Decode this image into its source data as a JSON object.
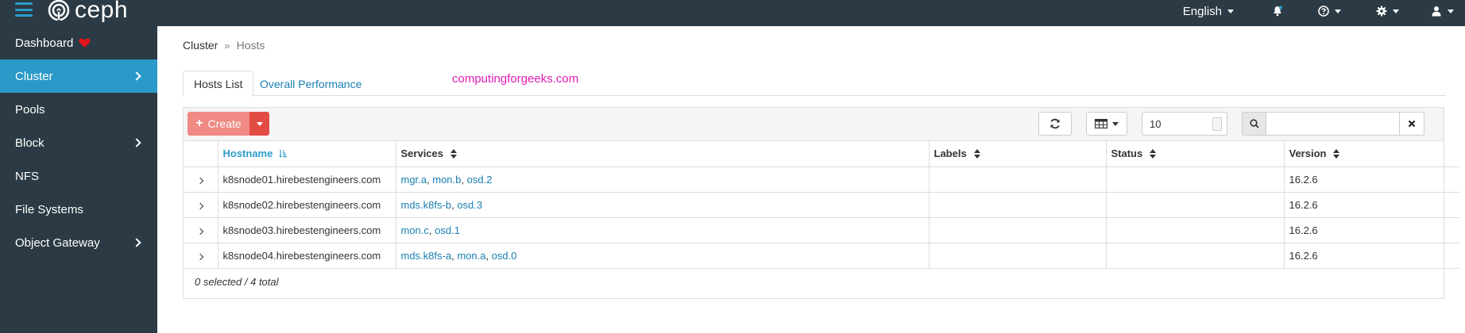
{
  "brand": {
    "name": "ceph"
  },
  "navbar": {
    "language": "English",
    "icons": [
      "bell-icon",
      "help-icon",
      "gear-icon",
      "user-icon"
    ]
  },
  "sidebar": {
    "items": [
      {
        "label": "Dashboard",
        "active": false,
        "has_children": false
      },
      {
        "label": "Cluster",
        "active": true,
        "has_children": true
      },
      {
        "label": "Pools",
        "active": false,
        "has_children": false
      },
      {
        "label": "Block",
        "active": false,
        "has_children": true
      },
      {
        "label": "NFS",
        "active": false,
        "has_children": false
      },
      {
        "label": "File Systems",
        "active": false,
        "has_children": false
      },
      {
        "label": "Object Gateway",
        "active": false,
        "has_children": true
      }
    ]
  },
  "breadcrumb": {
    "parent": "Cluster",
    "current": "Hosts"
  },
  "tabs": [
    {
      "label": "Hosts List",
      "active": true
    },
    {
      "label": "Overall Performance",
      "active": false
    }
  ],
  "watermark": "computingforgeeks.com",
  "toolbar": {
    "create_label": "Create",
    "page_size": "10",
    "search_value": ""
  },
  "table": {
    "columns": [
      "Hostname",
      "Services",
      "Labels",
      "Status",
      "Version"
    ],
    "sorted_column": "Hostname",
    "rows": [
      {
        "hostname": "k8snode01.hirebestengineers.com",
        "services": [
          "mgr.a",
          "mon.b",
          "osd.2"
        ],
        "labels": "",
        "status": "",
        "version": "16.2.6"
      },
      {
        "hostname": "k8snode02.hirebestengineers.com",
        "services": [
          "mds.k8fs-b",
          "osd.3"
        ],
        "labels": "",
        "status": "",
        "version": "16.2.6"
      },
      {
        "hostname": "k8snode03.hirebestengineers.com",
        "services": [
          "mon.c",
          "osd.1"
        ],
        "labels": "",
        "status": "",
        "version": "16.2.6"
      },
      {
        "hostname": "k8snode04.hirebestengineers.com",
        "services": [
          "mds.k8fs-a",
          "mon.a",
          "osd.0"
        ],
        "labels": "",
        "status": "",
        "version": "16.2.6"
      }
    ],
    "footer": "0 selected / 4 total"
  },
  "colors": {
    "nav_bg": "#2b3a44",
    "accent": "#2b9ac8",
    "create_button": "#f08a84",
    "create_split": "#e34c45",
    "link": "#1a7fb0",
    "watermark": "#e01eb5",
    "heart": "#e0161b"
  }
}
